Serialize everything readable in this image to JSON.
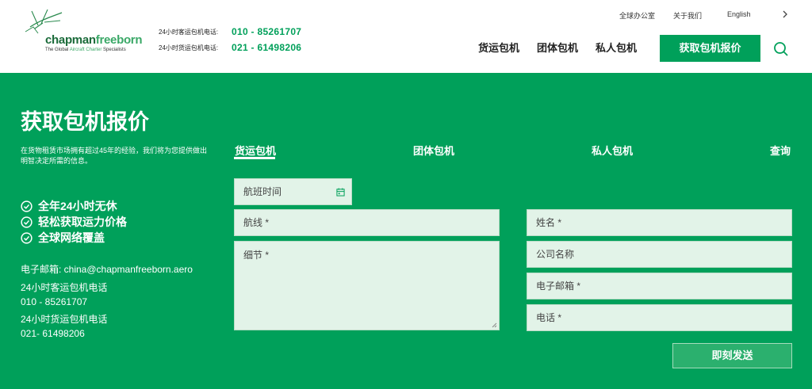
{
  "header": {
    "logo": {
      "brand_part1": "chapman",
      "brand_part2": "freeborn",
      "tagline_part1": "The Global ",
      "tagline_accent": "Aircraft Charter",
      "tagline_part2": " Specialists"
    },
    "phones": [
      {
        "label": "24小时客运包机电话:",
        "number": "010 - 85261707"
      },
      {
        "label": "24小时货运包机电话:",
        "number": "021 - 61498206"
      }
    ],
    "utility_nav": {
      "offices": "全球办公室",
      "about": "关于我们",
      "language": "English"
    },
    "main_nav": [
      "货运包机",
      "团体包机",
      "私人包机"
    ],
    "quote_button": "获取包机报价"
  },
  "hero": {
    "title": "获取包机报价",
    "intro": "在货物租赁市场拥有超过45年的经验，我们将为您提供做出明智决定所需的信息。",
    "features": [
      "全年24小时无休",
      "轻松获取运力价格",
      "全球网络覆盖"
    ],
    "contact": {
      "email_line": "电子邮箱: china@chapmanfreeborn.aero",
      "passenger_label": "24小时客运包机电话",
      "passenger_number": "010 - 85261707",
      "cargo_label": "24小时货运包机电话",
      "cargo_number": "021- 61498206"
    }
  },
  "form": {
    "tabs": [
      "货运包机",
      "团体包机",
      "私人包机",
      "查询"
    ],
    "active_tab": "货运包机",
    "fields": {
      "flight_time": "航班时间",
      "route": "航线 *",
      "details": "细节 *",
      "name": "姓名 *",
      "company": "公司名称",
      "email": "电子邮箱 *",
      "phone": "电话 *"
    },
    "submit": "即刻发送"
  },
  "colors": {
    "brand_green": "#00a05a",
    "field_bg": "#e2f3e8",
    "logo_dark_green": "#1b6b3a",
    "logo_light_green": "#3aa867"
  }
}
